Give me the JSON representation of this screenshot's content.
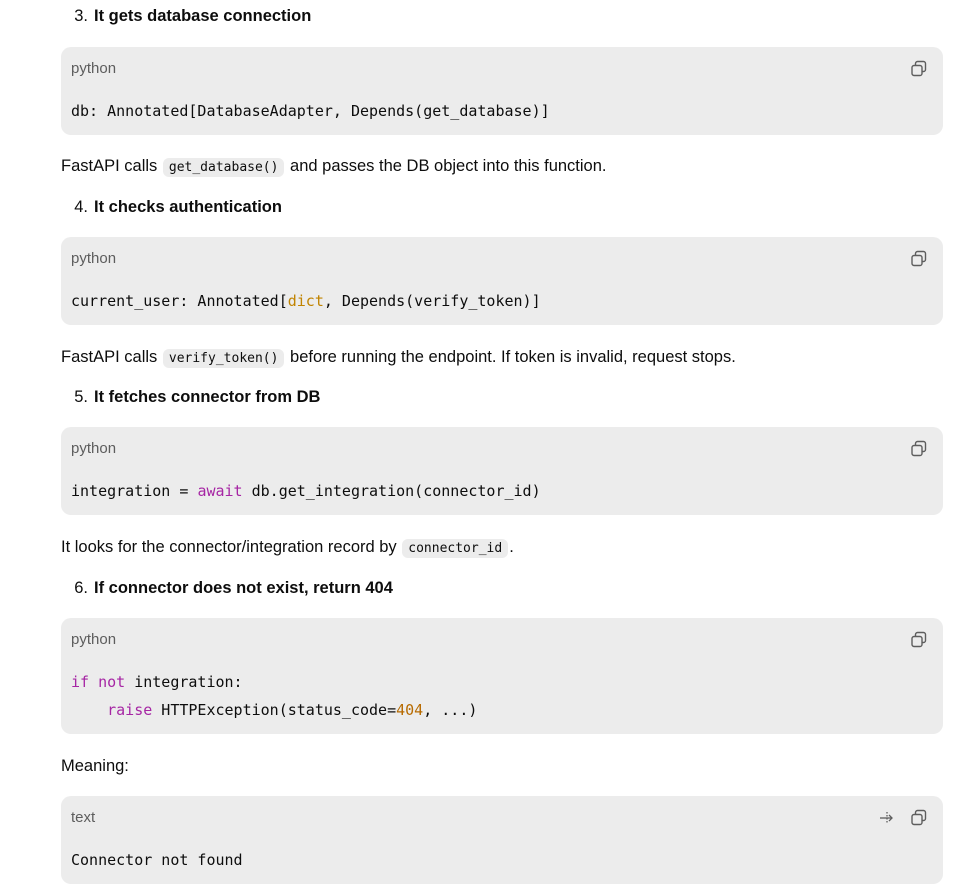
{
  "steps": [
    {
      "num": "3.",
      "title": "It gets database connection"
    },
    {
      "num": "4.",
      "title": "It checks authentication"
    },
    {
      "num": "5.",
      "title": "It fetches connector from DB"
    },
    {
      "num": "6.",
      "title": "If connector does not exist, return 404"
    }
  ],
  "blocks": {
    "b1": {
      "lang": "python",
      "line1": "db: Annotated[DatabaseAdapter, Depends(get_database)]"
    },
    "b2": {
      "lang": "python",
      "line1_a": "current_user: Annotated[",
      "line1_kw": "dict",
      "line1_b": ", Depends(verify_token)]"
    },
    "b3": {
      "lang": "python",
      "line1_a": "integration = ",
      "line1_kw": "await",
      "line1_b": " db.get_integration(connector_id)"
    },
    "b4": {
      "lang": "python",
      "l1_kw1": "if",
      "l1_sp": " ",
      "l1_kw2": "not",
      "l1_rest": " integration:",
      "l2_indent": "    ",
      "l2_kw": "raise",
      "l2_a": " HTTPException(status_code=",
      "l2_num": "404",
      "l2_b": ", ...)"
    },
    "b5": {
      "lang": "text",
      "line1": "Connector not found"
    }
  },
  "paras": {
    "p1": {
      "before": "FastAPI calls ",
      "code": "get_database()",
      "after": " and passes the DB object into this function."
    },
    "p2": {
      "before": "FastAPI calls ",
      "code": "verify_token()",
      "after": " before running the endpoint. If token is invalid, request stops."
    },
    "p3": {
      "before": "It looks for the connector/integration record by ",
      "code": "connector_id",
      "after": "."
    },
    "p4": {
      "text": "Meaning:"
    }
  },
  "icons": {
    "copy": "copy-icon",
    "wrap": "wrap-icon"
  },
  "colors": {
    "keyword": "#a626a4",
    "builtin": "#c18401",
    "number": "#b76b01",
    "code_bg": "#ececec"
  }
}
